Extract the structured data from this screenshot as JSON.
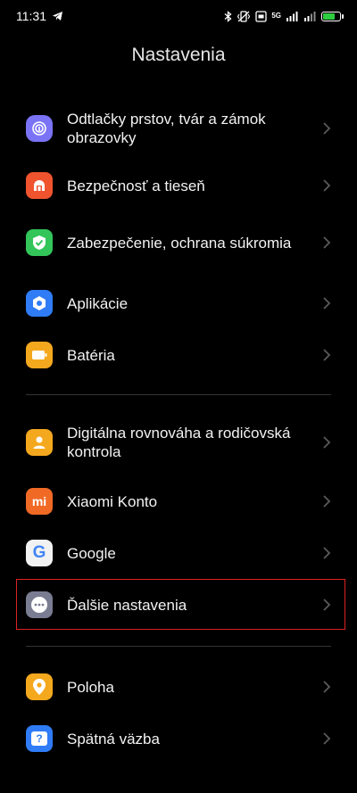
{
  "status": {
    "time": "11:31",
    "network": "5G"
  },
  "title": "Nastavenia",
  "items": [
    {
      "id": "fingerprint",
      "label": "Odtlačky prstov, tvár a zámok obrazovky",
      "color": "#7b73f5"
    },
    {
      "id": "security",
      "label": "Bezpečnosť a tieseň",
      "color": "#f0542e"
    },
    {
      "id": "privacy",
      "label": "Zabezpečenie, ochrana súkromia",
      "color": "#33c55a"
    },
    {
      "id": "apps",
      "label": "Aplikácie",
      "color": "#2f7cf6"
    },
    {
      "id": "battery",
      "label": "Batéria",
      "color": "#f4a81e"
    },
    {
      "id": "wellbeing",
      "label": "Digitálna rovnováha a rodičovská kontrola",
      "color": "#f4a81e"
    },
    {
      "id": "xiaomi",
      "label": "Xiaomi Konto",
      "color": "#f06a25",
      "icon_text": "mi"
    },
    {
      "id": "google",
      "label": "Google",
      "color": "#f2f2f2",
      "icon_text": "G"
    },
    {
      "id": "more",
      "label": "Ďalšie nastavenia",
      "color": "#7a7d92"
    },
    {
      "id": "location",
      "label": "Poloha",
      "color": "#f4a81e"
    },
    {
      "id": "feedback",
      "label": "Spätná väzba",
      "color": "#2f7cf6",
      "icon_text": "?"
    }
  ],
  "highlight_color": "#d22222"
}
